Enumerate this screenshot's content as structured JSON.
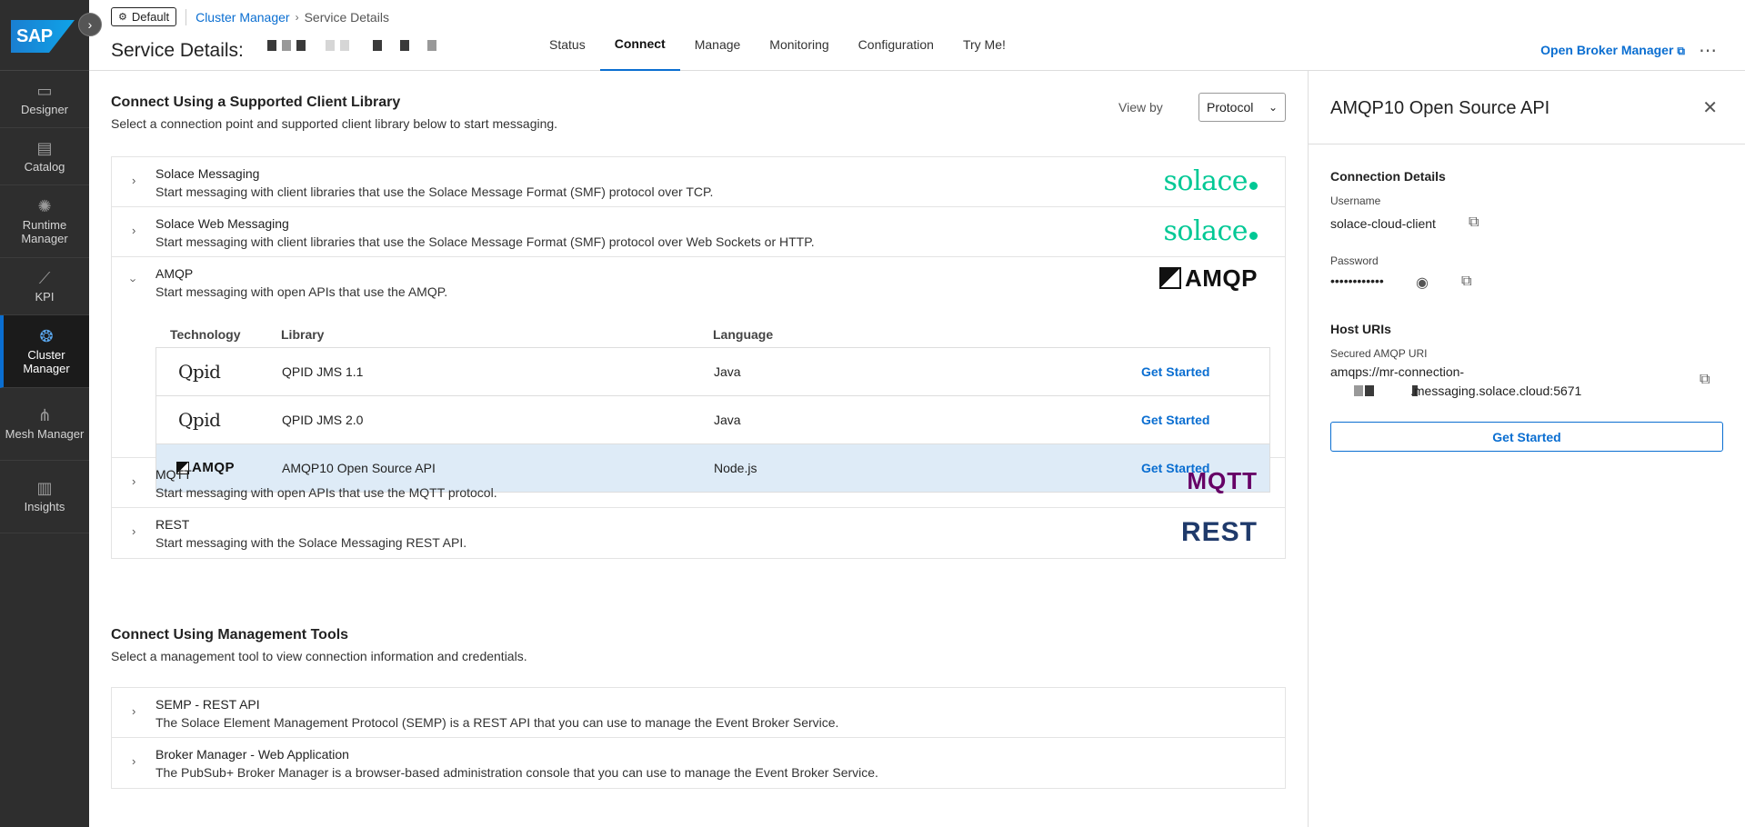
{
  "nav": {
    "logo_text": "SAP",
    "collapse_icon": "chevron-right-icon",
    "items": [
      {
        "label": "Designer",
        "icon": "designer-icon"
      },
      {
        "label": "Catalog",
        "icon": "catalog-icon"
      },
      {
        "label": "Runtime Manager",
        "icon": "runtime-icon"
      },
      {
        "label": "KPI",
        "icon": "chart-line-icon"
      },
      {
        "label": "Cluster Manager",
        "icon": "cluster-icon"
      },
      {
        "label": "Mesh Manager",
        "icon": "mesh-icon"
      },
      {
        "label": "Insights",
        "icon": "bar-chart-icon"
      }
    ],
    "active": "Cluster Manager"
  },
  "header": {
    "env_badge": "Default",
    "breadcrumb_link": "Cluster Manager",
    "breadcrumb_current": "Service Details",
    "title": "Service Details:",
    "tabs": [
      "Status",
      "Connect",
      "Manage",
      "Monitoring",
      "Configuration",
      "Try Me!"
    ],
    "active_tab": "Connect",
    "open_broker_label": "Open Broker Manager",
    "more_label": "..."
  },
  "main": {
    "client_section": {
      "title": "Connect Using a Supported Client Library",
      "subtitle": "Select a connection point and supported client library below to start messaging."
    },
    "view_by_label": "View by",
    "view_by_value": "Protocol",
    "protocols": [
      {
        "name": "Solace Messaging",
        "desc": "Start messaging with client libraries that use the Solace Message Format (SMF) protocol over TCP.",
        "logo": "solace"
      },
      {
        "name": "Solace Web Messaging",
        "desc": "Start messaging with client libraries that use the Solace Message Format (SMF) protocol over Web Sockets or HTTP.",
        "logo": "solace"
      },
      {
        "name": "AMQP",
        "desc": "Start messaging with open APIs that use the AMQP.",
        "logo": "AMQP"
      },
      {
        "name": "MQTT",
        "desc": "Start messaging with open APIs that use the MQTT protocol.",
        "logo": "MQTT"
      },
      {
        "name": "REST",
        "desc": "Start messaging with the Solace Messaging REST API.",
        "logo": "REST"
      }
    ],
    "lib_table": {
      "headers": [
        "Technology",
        "Library",
        "Language"
      ],
      "rows": [
        {
          "tech": "Qpid",
          "library": "QPID JMS 1.1",
          "language": "Java",
          "action": "Get Started"
        },
        {
          "tech": "Qpid",
          "library": "QPID JMS 2.0",
          "language": "Java",
          "action": "Get Started"
        },
        {
          "tech": "AMQP",
          "library": "AMQP10 Open Source API",
          "language": "Node.js",
          "action": "Get Started"
        }
      ]
    },
    "mgmt_section": {
      "title": "Connect Using Management Tools",
      "subtitle": "Select a management tool to view connection information and credentials."
    },
    "tools": [
      {
        "name": "SEMP - REST API",
        "desc": "The Solace Element Management Protocol (SEMP) is a REST API that you can use to manage the Event Broker Service."
      },
      {
        "name": "Broker Manager - Web Application",
        "desc": "The PubSub+ Broker Manager is a browser-based administration console that you can use to manage the Event Broker Service."
      }
    ]
  },
  "panel": {
    "title": "AMQP10 Open Source API",
    "connection_details": "Connection Details",
    "username_label": "Username",
    "username_value": "solace-cloud-client",
    "password_label": "Password",
    "password_value": "••••••••••••",
    "host_uris": "Host URIs",
    "uri_label": "Secured AMQP URI",
    "uri_line1": "amqps://mr-connection-",
    "uri_line2": ".messaging.solace.cloud:5671",
    "get_started": "Get Started"
  }
}
